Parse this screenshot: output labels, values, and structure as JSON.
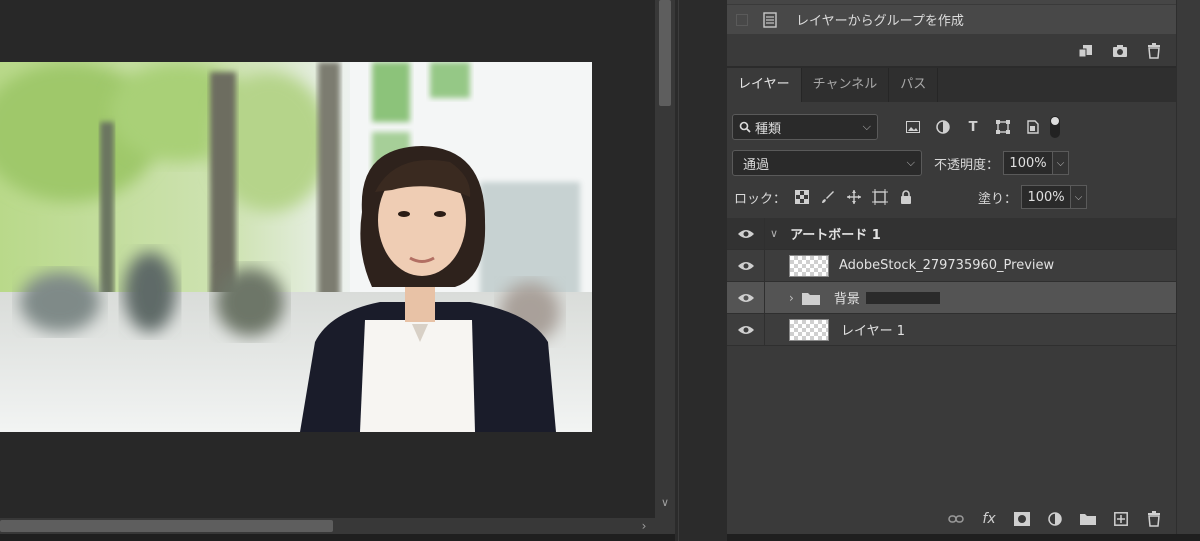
{
  "actions": {
    "row_label": "レイヤーからグループを作成",
    "footer_icons": [
      "new-action-icon",
      "camera-icon",
      "trash-icon"
    ]
  },
  "layers_panel": {
    "tabs": [
      {
        "label": "レイヤー",
        "active": true
      },
      {
        "label": "チャンネル",
        "active": false
      },
      {
        "label": "パス",
        "active": false
      }
    ],
    "filter": {
      "value": "種類"
    },
    "blend_mode": "通過",
    "opacity_label": "不透明度：",
    "opacity_value": "100%",
    "lock_label": "ロック：",
    "fill_label": "塗り：",
    "fill_value": "100%",
    "layers": [
      {
        "name": "アートボード 1",
        "type": "artboard"
      },
      {
        "name": "AdobeStock_279735960_Preview",
        "type": "smart-object"
      },
      {
        "name": "背景",
        "type": "group",
        "selected": true
      },
      {
        "name": "レイヤー 1",
        "type": "pixel"
      }
    ],
    "footer_icons": [
      "link-icon",
      "fx-icon",
      "mask-icon",
      "adjustment-icon",
      "folder-icon",
      "new-layer-icon",
      "trash-icon"
    ]
  },
  "colors": {
    "panel_bg": "#3a3a3a",
    "canvas_bg": "#282828",
    "selected_row": "#545454"
  }
}
